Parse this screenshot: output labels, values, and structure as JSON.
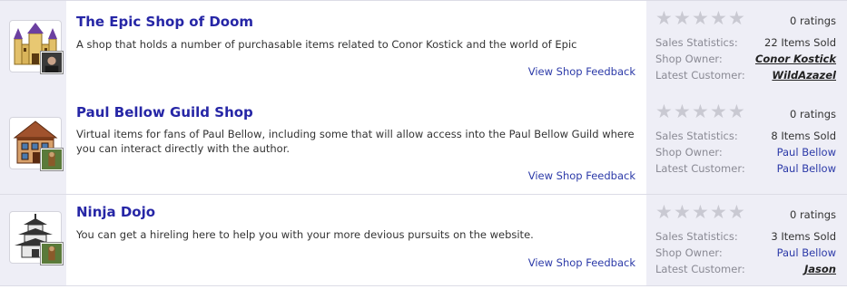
{
  "shops": [
    {
      "title": "The Epic Shop of Doom",
      "description": "A shop that holds a number of purchasable items related to Conor Kostick and the world of Epic",
      "feedback_link": "View Shop Feedback",
      "thumbnail_icon": "castle-icon",
      "owner_avatar_icon": "owner-photo-avatar",
      "ratings": "0 ratings",
      "stars": 0,
      "stats": {
        "sales_label": "Sales Statistics:",
        "sales_value": "22 Items Sold",
        "owner_label": "Shop Owner:",
        "owner_value": "Conor Kostick",
        "customer_label": "Latest Customer:",
        "customer_value": "WildAzazel"
      }
    },
    {
      "title": "Paul Bellow Guild Shop",
      "description": "Virtual items for fans of Paul Bellow, including some that will allow access into the Paul Bellow Guild where you can interact directly with the author.",
      "feedback_link": "View Shop Feedback",
      "thumbnail_icon": "house-icon",
      "owner_avatar_icon": "owner-avatar",
      "ratings": "0 ratings",
      "stars": 0,
      "stats": {
        "sales_label": "Sales Statistics:",
        "sales_value": "8 Items Sold",
        "owner_label": "Shop Owner:",
        "owner_value": "Paul Bellow",
        "customer_label": "Latest Customer:",
        "customer_value": "Paul Bellow"
      }
    },
    {
      "title": "Ninja Dojo",
      "description": "You can get a hireling here to help you with your more devious pursuits on the website.",
      "feedback_link": "View Shop Feedback",
      "thumbnail_icon": "pagoda-icon",
      "owner_avatar_icon": "owner-avatar",
      "ratings": "0 ratings",
      "stars": 0,
      "stats": {
        "sales_label": "Sales Statistics:",
        "sales_value": "3 Items Sold",
        "owner_label": "Shop Owner:",
        "owner_value": "Paul Bellow",
        "customer_label": "Latest Customer:",
        "customer_value": "Jason"
      }
    }
  ],
  "colors": {
    "title": "#2626a6",
    "link": "#2c3aa8",
    "panel_bg": "#eeeef6",
    "star_empty": "#c9c9d2"
  }
}
